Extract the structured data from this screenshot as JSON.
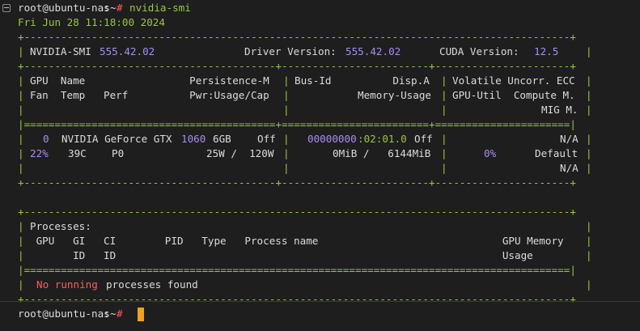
{
  "terminal": {
    "prompt": {
      "user_host": "root@ubuntu-nas",
      "colon": ":",
      "cwd": "~",
      "symbol": "#"
    },
    "command": "nvidia-smi",
    "timestamp": "Fri Jun 28 11:18:00 2024",
    "output": {
      "border_dash": "+-----------------------------------------------------------------------------------------+",
      "border_eq_gpu": "|=========================================+========================+======================|",
      "border_mid": "+-----------------------------------------+------------------------+----------------------+",
      "border_eq_proc": "|=========================================================================================|",
      "pipe": "|",
      "header": {
        "smi_label": "NVIDIA-SMI",
        "smi_version": "555.42.02",
        "driver_label": "Driver Version:",
        "driver_version": "555.42.02",
        "cuda_label": "CUDA Version:",
        "cuda_version": "12.5"
      },
      "gpu_cols": {
        "row1_left": "GPU  Name                 Persistence-M",
        "row1_mid": "Bus-Id          Disp.A",
        "row1_right": "Volatile Uncorr. ECC",
        "row2_left": "Fan  Temp   Perf          Pwr:Usage/Cap",
        "row2_mid": "Memory-Usage",
        "row2_right": "GPU-Util  Compute M.",
        "row3_right": "MIG M."
      },
      "gpu_row": {
        "index": "0",
        "name_a": "NVIDIA GeForce GTX",
        "name_num": "1060",
        "name_b": "6GB",
        "persistence": "Off",
        "bus_id_num": "00000000",
        "bus_id_rest": ":02:01.0",
        "disp": "Off",
        "ecc": "N/A",
        "fan": "22%",
        "temp": "39C",
        "perf": "P0",
        "pwr": "25W /  120W",
        "memory": "0MiB /   6144MiB",
        "util": "0%",
        "compute": "Default",
        "mig": "N/A"
      },
      "processes": {
        "title": "Processes:",
        "cols_row1": " GPU   GI   CI        PID   Type   Process name                              GPU Memory",
        "cols_row2": "       ID   ID                                                               Usage",
        "none_red": "No running",
        "none_rest": "processes found"
      }
    }
  }
}
